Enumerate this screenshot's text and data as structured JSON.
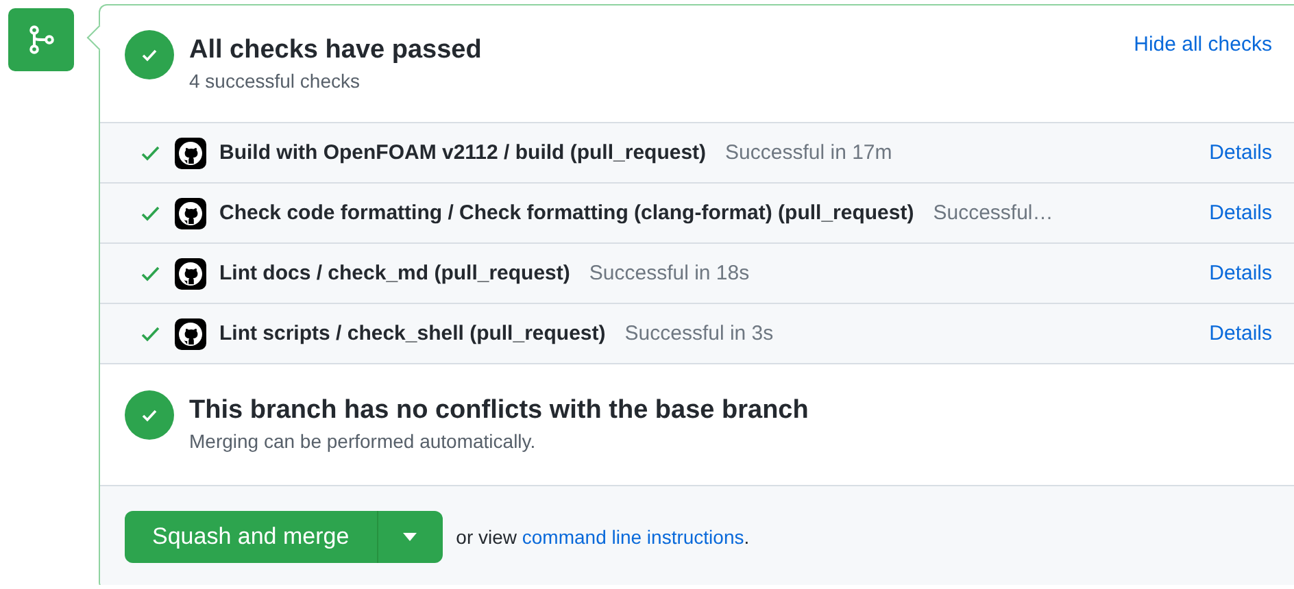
{
  "summary": {
    "title": "All checks have passed",
    "subtitle": "4 successful checks",
    "toggle": "Hide all checks",
    "passed": true
  },
  "checks": [
    {
      "name": "Build with OpenFOAM v2112 / build (pull_request)",
      "status": "Successful in 17m",
      "link": "Details",
      "passed": true
    },
    {
      "name": "Check code formatting / Check formatting (clang-format) (pull_request)",
      "status": "Successful…",
      "link": "Details",
      "passed": true
    },
    {
      "name": "Lint docs / check_md (pull_request)",
      "status": "Successful in 18s",
      "link": "Details",
      "passed": true
    },
    {
      "name": "Lint scripts / check_shell (pull_request)",
      "status": "Successful in 3s",
      "link": "Details",
      "passed": true
    }
  ],
  "conflicts": {
    "title": "This branch has no conflicts with the base branch",
    "subtitle": "Merging can be performed automatically.",
    "passed": true
  },
  "merge": {
    "button": "Squash and merge",
    "prefix": "or view",
    "link": "command line instructions",
    "suffix": "."
  }
}
